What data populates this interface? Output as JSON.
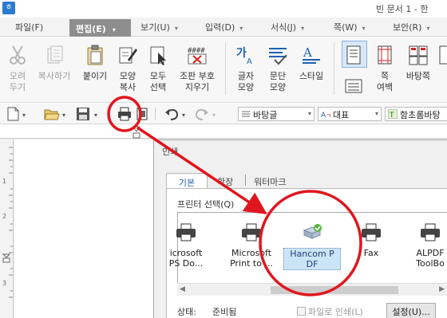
{
  "window": {
    "title": "빈 문서 1 - 한",
    "app_icon_glyph": "ㅎ"
  },
  "menu": {
    "file": "파일(F)",
    "edit": "편집(E)",
    "view": "보기(U)",
    "insert": "입력(D)",
    "format": "서식(J)",
    "page": "쪽(W)",
    "security": "보안(R)"
  },
  "ribbon": {
    "cut": "오려\n두기",
    "copy": "복사하기",
    "paste": "붙이기",
    "format_copy": "모양\n복사",
    "select_all": "모두\n선택",
    "delete_codes": "조판 부호\n지우기",
    "char_shape": "글자\n모양",
    "para_shape": "문단\n모양",
    "style": "스타일",
    "page_margin": "쪽\n여백",
    "background": "바탕쪽"
  },
  "toolbar": {
    "style_value": "바탕글",
    "lang_value": "대표",
    "font_value": "함초롬바탕"
  },
  "dialog": {
    "title": "인쇄",
    "tabs": [
      "기본",
      "확장",
      "워터마크"
    ],
    "printer_select_label": "프린터 선택(Q)",
    "printers": [
      {
        "name": "icrosoft\nPS Do..."
      },
      {
        "name": "Microsoft\nPrint to ..."
      },
      {
        "name": "Hancom P\nDF"
      },
      {
        "name": "Fax"
      },
      {
        "name": "ALPDF\nToolBo"
      }
    ],
    "selected_printer": "Hancom PDF",
    "status_label": "상태:",
    "status_value": "준비됨",
    "print_to_file": "파일로 인쇄(L)",
    "settings_button": "설정(U)..."
  },
  "colors": {
    "annotation": "#e0161e",
    "menu_active_bg": "#8e8e8e",
    "selection": "#cce4f7"
  },
  "ruler": {
    "left_marks": [
      "1",
      "2",
      "3"
    ]
  }
}
